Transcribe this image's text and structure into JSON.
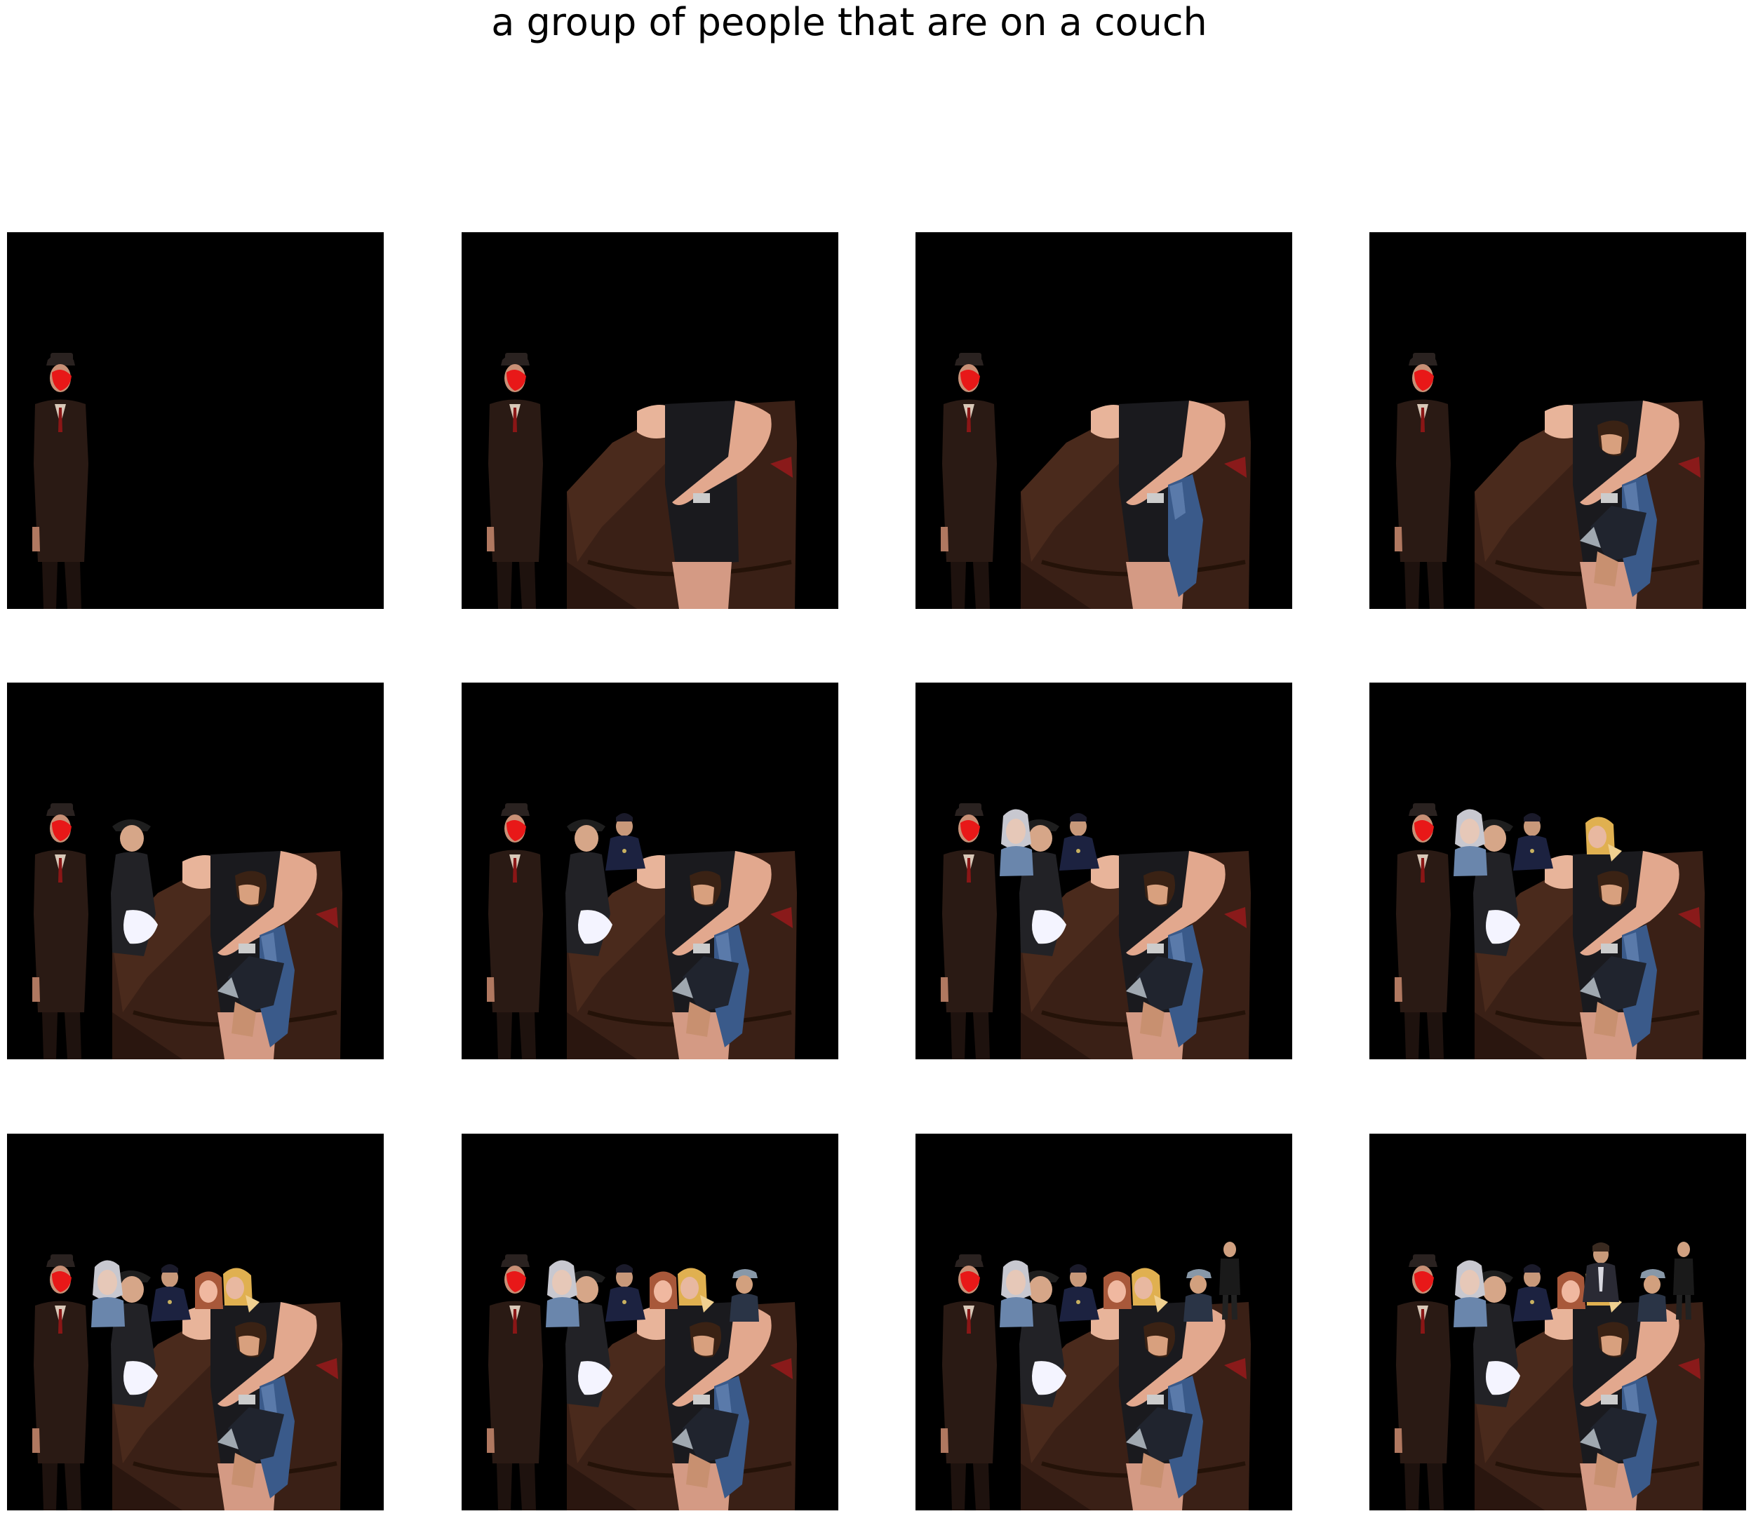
{
  "title": "a group of people that are on a couch",
  "grid": {
    "rows": 3,
    "columns": 4
  },
  "panels": [
    {
      "step": 1,
      "layers": [
        "man-in-suit"
      ]
    },
    {
      "step": 2,
      "layers": [
        "man-in-suit",
        "couch",
        "woman-black-dress"
      ]
    },
    {
      "step": 3,
      "layers": [
        "man-in-suit",
        "couch",
        "woman-black-dress",
        "jeans-person"
      ]
    },
    {
      "step": 4,
      "layers": [
        "man-in-suit",
        "couch",
        "woman-black-dress",
        "jeans-person",
        "dark-haired-person"
      ]
    },
    {
      "step": 5,
      "layers": [
        "man-in-suit",
        "couch",
        "woman-black-dress",
        "jeans-person",
        "dark-haired-person",
        "woman-in-hat"
      ]
    },
    {
      "step": 6,
      "layers": [
        "man-in-suit",
        "couch",
        "woman-black-dress",
        "jeans-person",
        "dark-haired-person",
        "woman-in-hat",
        "uniformed-man"
      ]
    },
    {
      "step": 7,
      "layers": [
        "man-in-suit",
        "couch",
        "woman-black-dress",
        "jeans-person",
        "dark-haired-person",
        "woman-in-hat",
        "uniformed-man",
        "woman-denim-jacket"
      ]
    },
    {
      "step": 8,
      "layers": [
        "man-in-suit",
        "couch",
        "woman-black-dress",
        "jeans-person",
        "dark-haired-person",
        "woman-in-hat",
        "uniformed-man",
        "woman-denim-jacket",
        "blonde-woman"
      ]
    },
    {
      "step": 9,
      "layers": [
        "man-in-suit",
        "couch",
        "woman-black-dress",
        "jeans-person",
        "dark-haired-person",
        "woman-in-hat",
        "uniformed-man",
        "woman-denim-jacket",
        "blonde-woman",
        "redhead-woman"
      ]
    },
    {
      "step": 10,
      "layers": [
        "man-in-suit",
        "couch",
        "woman-black-dress",
        "jeans-person",
        "dark-haired-person",
        "woman-in-hat",
        "uniformed-man",
        "woman-denim-jacket",
        "blonde-woman",
        "redhead-woman",
        "man-in-cap"
      ]
    },
    {
      "step": 11,
      "layers": [
        "man-in-suit",
        "couch",
        "woman-black-dress",
        "jeans-person",
        "dark-haired-person",
        "woman-in-hat",
        "uniformed-man",
        "woman-denim-jacket",
        "blonde-woman",
        "redhead-woman",
        "man-in-cap",
        "standing-man"
      ]
    },
    {
      "step": 12,
      "layers": [
        "man-in-suit",
        "couch",
        "woman-black-dress",
        "jeans-person",
        "dark-haired-person",
        "woman-in-hat",
        "uniformed-man",
        "woman-denim-jacket",
        "blonde-woman",
        "redhead-woman",
        "man-in-cap",
        "standing-man",
        "man-in-jacket"
      ]
    }
  ]
}
